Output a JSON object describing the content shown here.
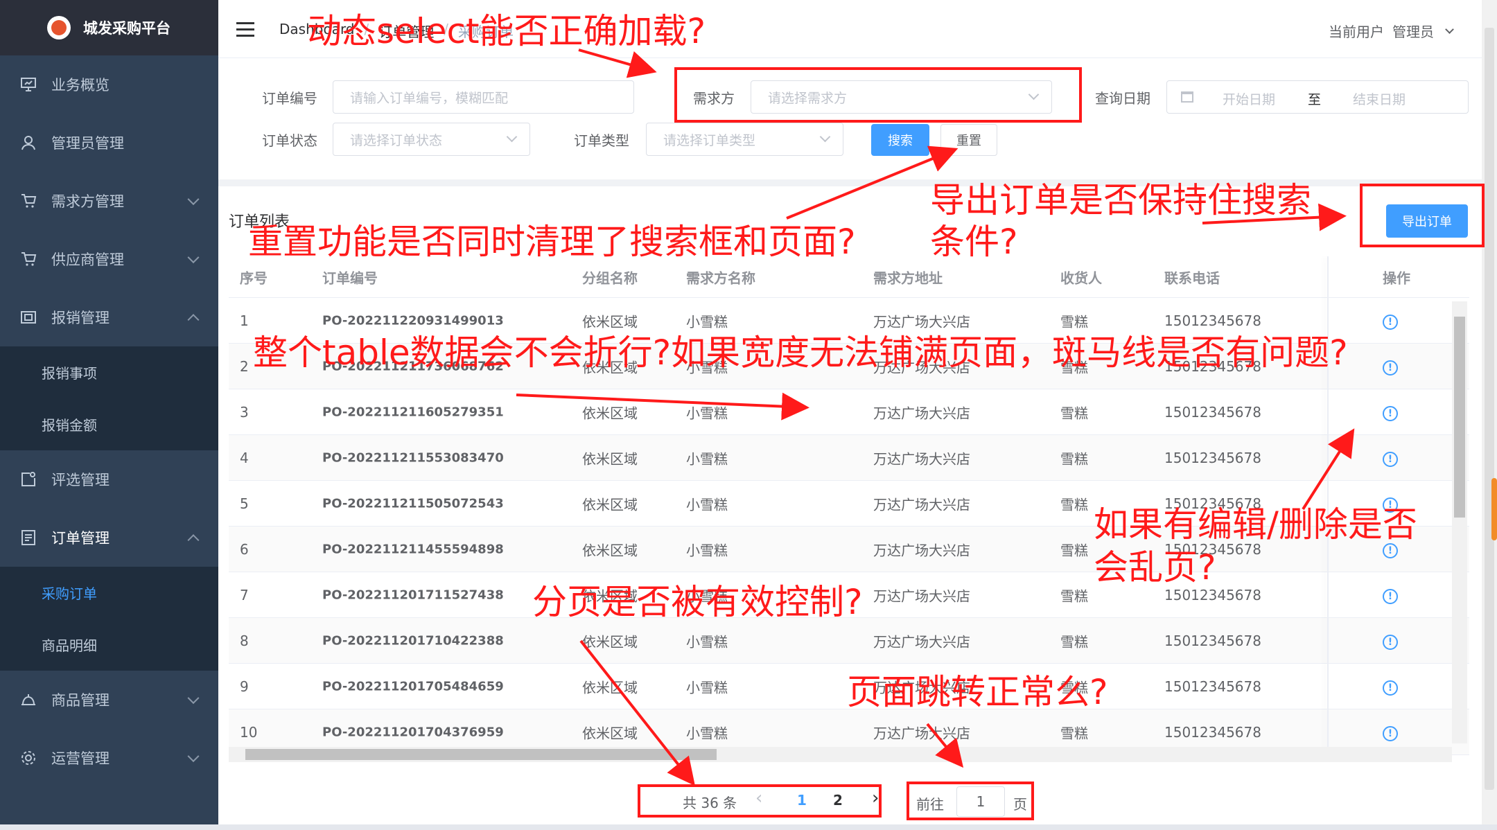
{
  "app": {
    "title": "城发采购平台"
  },
  "sidebar": {
    "items": [
      {
        "label": "业务概览",
        "icon": "monitor-icon"
      },
      {
        "label": "管理员管理",
        "icon": "user-icon"
      },
      {
        "label": "需求方管理",
        "icon": "cart-icon"
      },
      {
        "label": "供应商管理",
        "icon": "cart-icon"
      },
      {
        "label": "报销管理",
        "icon": "receipt-icon"
      },
      {
        "label": "评选管理",
        "icon": "review-icon"
      },
      {
        "label": "订单管理",
        "icon": "document-icon"
      },
      {
        "label": "商品管理",
        "icon": "bag-icon"
      },
      {
        "label": "运营管理",
        "icon": "gear-icon"
      }
    ],
    "reimburse_sub": [
      "报销事项",
      "报销金额"
    ],
    "order_sub": [
      "采购订单",
      "商品明细"
    ]
  },
  "header": {
    "breadcrumb": [
      "Dashboard",
      "订单管理",
      "采购订单"
    ],
    "user_label": "当前用户",
    "user_name": "管理员"
  },
  "filters": {
    "order_no_label": "订单编号",
    "order_no_placeholder": "请输入订单编号，模糊匹配",
    "demand_label": "需求方",
    "demand_placeholder": "请选择需求方",
    "date_label": "查询日期",
    "date_start": "开始日期",
    "date_to": "至",
    "date_end": "结束日期",
    "status_label": "订单状态",
    "status_placeholder": "请选择订单状态",
    "type_label": "订单类型",
    "type_placeholder": "请选择订单类型",
    "search_btn": "搜索",
    "reset_btn": "重置"
  },
  "table": {
    "title": "订单列表",
    "export_btn": "导出订单",
    "columns": [
      "序号",
      "订单编号",
      "分组名称",
      "需求方名称",
      "需求方地址",
      "收货人",
      "联系电话",
      "操作"
    ],
    "rows": [
      [
        "1",
        "PO-202211220931499013",
        "依米区域",
        "小雪糕",
        "万达广场大兴店",
        "雪糕",
        "15012345678"
      ],
      [
        "2",
        "PO-202211211736068762",
        "依米区域",
        "小雪糕",
        "万达广场大兴店",
        "雪糕",
        "15012345678"
      ],
      [
        "3",
        "PO-202211211605279351",
        "依米区域",
        "小雪糕",
        "万达广场大兴店",
        "雪糕",
        "15012345678"
      ],
      [
        "4",
        "PO-202211211553083470",
        "依米区域",
        "小雪糕",
        "万达广场大兴店",
        "雪糕",
        "15012345678"
      ],
      [
        "5",
        "PO-202211211505072543",
        "依米区域",
        "小雪糕",
        "万达广场大兴店",
        "雪糕",
        "15012345678"
      ],
      [
        "6",
        "PO-202211211455594898",
        "依米区域",
        "小雪糕",
        "万达广场大兴店",
        "雪糕",
        "15012345678"
      ],
      [
        "7",
        "PO-202211201711527438",
        "依米区域",
        "小雪糕",
        "万达广场大兴店",
        "雪糕",
        "15012345678"
      ],
      [
        "8",
        "PO-202211201710422388",
        "依米区域",
        "小雪糕",
        "万达广场大兴店",
        "雪糕",
        "15012345678"
      ],
      [
        "9",
        "PO-202211201705484659",
        "依米区域",
        "小雪糕",
        "万达广场大兴店",
        "雪糕",
        "15012345678"
      ],
      [
        "10",
        "PO-202211201704376959",
        "依米区域",
        "小雪糕",
        "万达广场大兴店",
        "雪糕",
        "15012345678"
      ]
    ]
  },
  "pagination": {
    "total": "共 36 条",
    "prev": "‹",
    "page1": "1",
    "page2": "2",
    "next": "›",
    "goto_label": "前往",
    "goto_value": "1",
    "goto_unit": "页"
  },
  "annotations": {
    "a1": "动态select能否正确加载?",
    "a2": "重置功能是否同时清理了搜索框和页面?",
    "a3": "导出订单是否保持住搜索",
    "a3b": "条件?",
    "a4": "整个table数据会不会折行?如果宽度无法铺满页面，斑马线是否有问题?",
    "a5": "如果有编辑/删除是否",
    "a5b": "会乱页?",
    "a6": "分页是否被有效控制?",
    "a7": "页面跳转正常么?"
  },
  "colors": {
    "sidebar": "#304156",
    "accent": "#409eff",
    "annotation": "#ff1a1a"
  }
}
